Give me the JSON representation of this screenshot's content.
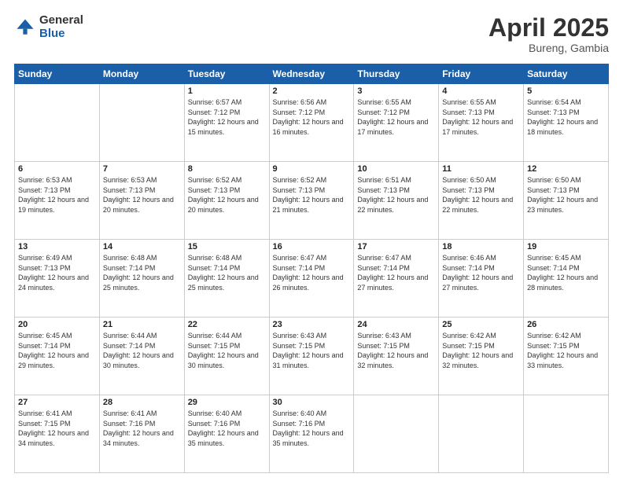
{
  "logo": {
    "general": "General",
    "blue": "Blue"
  },
  "title": {
    "month_year": "April 2025",
    "location": "Bureng, Gambia"
  },
  "days_of_week": [
    "Sunday",
    "Monday",
    "Tuesday",
    "Wednesday",
    "Thursday",
    "Friday",
    "Saturday"
  ],
  "weeks": [
    [
      {
        "day": "",
        "info": ""
      },
      {
        "day": "",
        "info": ""
      },
      {
        "day": "1",
        "info": "Sunrise: 6:57 AM\nSunset: 7:12 PM\nDaylight: 12 hours and 15 minutes."
      },
      {
        "day": "2",
        "info": "Sunrise: 6:56 AM\nSunset: 7:12 PM\nDaylight: 12 hours and 16 minutes."
      },
      {
        "day": "3",
        "info": "Sunrise: 6:55 AM\nSunset: 7:12 PM\nDaylight: 12 hours and 17 minutes."
      },
      {
        "day": "4",
        "info": "Sunrise: 6:55 AM\nSunset: 7:13 PM\nDaylight: 12 hours and 17 minutes."
      },
      {
        "day": "5",
        "info": "Sunrise: 6:54 AM\nSunset: 7:13 PM\nDaylight: 12 hours and 18 minutes."
      }
    ],
    [
      {
        "day": "6",
        "info": "Sunrise: 6:53 AM\nSunset: 7:13 PM\nDaylight: 12 hours and 19 minutes."
      },
      {
        "day": "7",
        "info": "Sunrise: 6:53 AM\nSunset: 7:13 PM\nDaylight: 12 hours and 20 minutes."
      },
      {
        "day": "8",
        "info": "Sunrise: 6:52 AM\nSunset: 7:13 PM\nDaylight: 12 hours and 20 minutes."
      },
      {
        "day": "9",
        "info": "Sunrise: 6:52 AM\nSunset: 7:13 PM\nDaylight: 12 hours and 21 minutes."
      },
      {
        "day": "10",
        "info": "Sunrise: 6:51 AM\nSunset: 7:13 PM\nDaylight: 12 hours and 22 minutes."
      },
      {
        "day": "11",
        "info": "Sunrise: 6:50 AM\nSunset: 7:13 PM\nDaylight: 12 hours and 22 minutes."
      },
      {
        "day": "12",
        "info": "Sunrise: 6:50 AM\nSunset: 7:13 PM\nDaylight: 12 hours and 23 minutes."
      }
    ],
    [
      {
        "day": "13",
        "info": "Sunrise: 6:49 AM\nSunset: 7:13 PM\nDaylight: 12 hours and 24 minutes."
      },
      {
        "day": "14",
        "info": "Sunrise: 6:48 AM\nSunset: 7:14 PM\nDaylight: 12 hours and 25 minutes."
      },
      {
        "day": "15",
        "info": "Sunrise: 6:48 AM\nSunset: 7:14 PM\nDaylight: 12 hours and 25 minutes."
      },
      {
        "day": "16",
        "info": "Sunrise: 6:47 AM\nSunset: 7:14 PM\nDaylight: 12 hours and 26 minutes."
      },
      {
        "day": "17",
        "info": "Sunrise: 6:47 AM\nSunset: 7:14 PM\nDaylight: 12 hours and 27 minutes."
      },
      {
        "day": "18",
        "info": "Sunrise: 6:46 AM\nSunset: 7:14 PM\nDaylight: 12 hours and 27 minutes."
      },
      {
        "day": "19",
        "info": "Sunrise: 6:45 AM\nSunset: 7:14 PM\nDaylight: 12 hours and 28 minutes."
      }
    ],
    [
      {
        "day": "20",
        "info": "Sunrise: 6:45 AM\nSunset: 7:14 PM\nDaylight: 12 hours and 29 minutes."
      },
      {
        "day": "21",
        "info": "Sunrise: 6:44 AM\nSunset: 7:14 PM\nDaylight: 12 hours and 30 minutes."
      },
      {
        "day": "22",
        "info": "Sunrise: 6:44 AM\nSunset: 7:15 PM\nDaylight: 12 hours and 30 minutes."
      },
      {
        "day": "23",
        "info": "Sunrise: 6:43 AM\nSunset: 7:15 PM\nDaylight: 12 hours and 31 minutes."
      },
      {
        "day": "24",
        "info": "Sunrise: 6:43 AM\nSunset: 7:15 PM\nDaylight: 12 hours and 32 minutes."
      },
      {
        "day": "25",
        "info": "Sunrise: 6:42 AM\nSunset: 7:15 PM\nDaylight: 12 hours and 32 minutes."
      },
      {
        "day": "26",
        "info": "Sunrise: 6:42 AM\nSunset: 7:15 PM\nDaylight: 12 hours and 33 minutes."
      }
    ],
    [
      {
        "day": "27",
        "info": "Sunrise: 6:41 AM\nSunset: 7:15 PM\nDaylight: 12 hours and 34 minutes."
      },
      {
        "day": "28",
        "info": "Sunrise: 6:41 AM\nSunset: 7:16 PM\nDaylight: 12 hours and 34 minutes."
      },
      {
        "day": "29",
        "info": "Sunrise: 6:40 AM\nSunset: 7:16 PM\nDaylight: 12 hours and 35 minutes."
      },
      {
        "day": "30",
        "info": "Sunrise: 6:40 AM\nSunset: 7:16 PM\nDaylight: 12 hours and 35 minutes."
      },
      {
        "day": "",
        "info": ""
      },
      {
        "day": "",
        "info": ""
      },
      {
        "day": "",
        "info": ""
      }
    ]
  ]
}
